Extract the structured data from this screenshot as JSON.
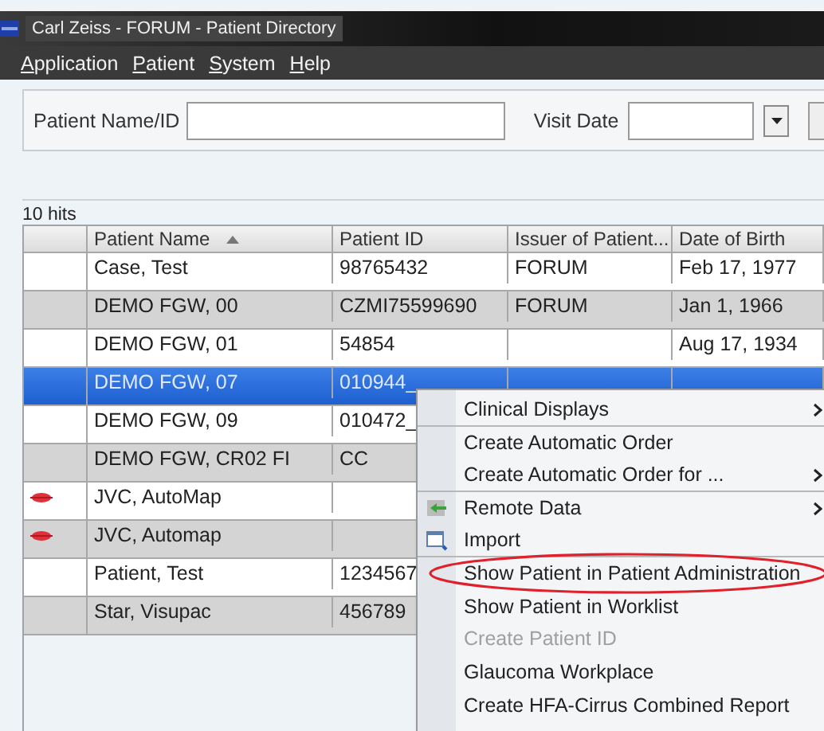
{
  "window": {
    "title": "Carl Zeiss - FORUM - Patient Directory"
  },
  "menu_bar": [
    {
      "label": "Application"
    },
    {
      "label": "Patient"
    },
    {
      "label": "System"
    },
    {
      "label": "Help"
    }
  ],
  "search": {
    "name_label": "Patient Name/ID",
    "date_label": "Visit Date"
  },
  "hits": "10 hits",
  "table": {
    "columns": [
      {
        "label": "Patient Name",
        "sorted": true
      },
      {
        "label": "Patient ID",
        "sorted": false
      },
      {
        "label": "Issuer of Patient...",
        "sorted": false
      },
      {
        "label": "Date of Birth",
        "sorted": false
      }
    ],
    "rows": [
      {
        "flagged": false,
        "selected": false,
        "cells": [
          "Case, Test",
          "98765432",
          "FORUM",
          "Feb 17, 1977"
        ]
      },
      {
        "flagged": false,
        "selected": false,
        "cells": [
          "DEMO FGW, 00",
          "CZMI75599690",
          "FORUM",
          "Jan 1, 1966"
        ]
      },
      {
        "flagged": false,
        "selected": false,
        "cells": [
          "DEMO FGW, 01",
          "54854",
          "",
          "Aug 17, 1934"
        ]
      },
      {
        "flagged": false,
        "selected": true,
        "cells": [
          "DEMO FGW, 07",
          "010944_",
          "",
          ""
        ]
      },
      {
        "flagged": false,
        "selected": false,
        "cells": [
          "DEMO FGW, 09",
          "010472_",
          "",
          ""
        ]
      },
      {
        "flagged": false,
        "selected": false,
        "cells": [
          "DEMO FGW, CR02 FI",
          "CC",
          "",
          ""
        ]
      },
      {
        "flagged": true,
        "selected": false,
        "cells": [
          "JVC, AutoMap",
          "",
          "",
          ""
        ]
      },
      {
        "flagged": true,
        "selected": false,
        "cells": [
          "JVC, Automap",
          "",
          "",
          ""
        ]
      },
      {
        "flagged": false,
        "selected": false,
        "cells": [
          "Patient, Test",
          "1234567",
          "",
          ""
        ]
      },
      {
        "flagged": false,
        "selected": false,
        "cells": [
          "Star, Visupac",
          "456789",
          "",
          ""
        ]
      }
    ]
  },
  "context_menu": [
    {
      "kind": "plain",
      "label": "Clinical Displays",
      "submenu": true,
      "disabled": false,
      "highlighted": false,
      "separator_after": true
    },
    {
      "kind": "plain",
      "label": "Create Automatic Order",
      "submenu": false,
      "disabled": false,
      "highlighted": false,
      "separator_after": false
    },
    {
      "kind": "plain",
      "label": "Create Automatic Order for ...",
      "submenu": true,
      "disabled": false,
      "highlighted": false,
      "separator_after": true
    },
    {
      "kind": "remote",
      "label": "Remote Data",
      "submenu": true,
      "disabled": false,
      "highlighted": false,
      "separator_after": false
    },
    {
      "kind": "import",
      "label": "Import",
      "submenu": false,
      "disabled": false,
      "highlighted": false,
      "separator_after": true
    },
    {
      "kind": "plain",
      "label": "Show Patient in Patient Administration",
      "submenu": false,
      "disabled": false,
      "highlighted": true,
      "separator_after": false
    },
    {
      "kind": "plain",
      "label": "Show Patient in Worklist",
      "submenu": false,
      "disabled": false,
      "highlighted": false,
      "separator_after": false
    },
    {
      "kind": "plain",
      "label": "Create Patient ID",
      "submenu": false,
      "disabled": true,
      "highlighted": false,
      "separator_after": false
    },
    {
      "kind": "plain",
      "label": "Glaucoma Workplace",
      "submenu": false,
      "disabled": false,
      "highlighted": false,
      "separator_after": false
    },
    {
      "kind": "plain",
      "label": "Create HFA-Cirrus Combined Report",
      "submenu": false,
      "disabled": false,
      "highlighted": false,
      "separator_after": false
    }
  ]
}
